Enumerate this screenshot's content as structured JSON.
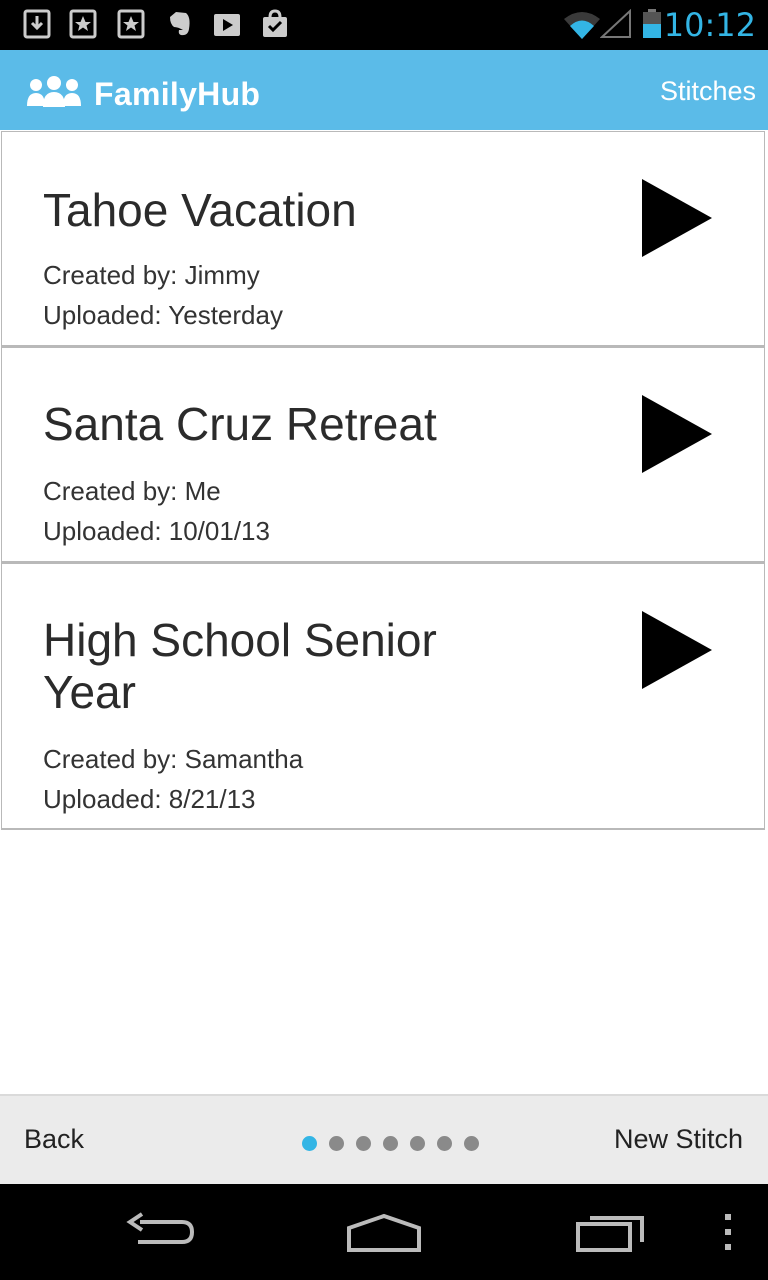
{
  "status_bar": {
    "time": "10:12",
    "accent_color": "#33b5e5",
    "notification_icons": [
      "download-icon",
      "bookmark-star-icon",
      "bookmark-star-icon",
      "evernote-icon",
      "play-store-icon",
      "shopping-bag-check-icon"
    ],
    "system_icons": [
      "wifi-icon",
      "signal-icon",
      "battery-icon"
    ]
  },
  "app_bar": {
    "title": "FamilyHub",
    "action_label": "Stitches",
    "logo_icon": "family-people-icon",
    "color": "#5bbbe8"
  },
  "stitches": [
    {
      "title": "Tahoe Vacation",
      "created_by": "Created by: Jimmy",
      "uploaded": "Uploaded: Yesterday"
    },
    {
      "title": "Santa Cruz Retreat",
      "created_by": "Created by: Me",
      "uploaded": "Uploaded: 10/01/13"
    },
    {
      "title": "High School Senior Year",
      "created_by": "Created by: Samantha",
      "uploaded": "Uploaded: 8/21/13"
    }
  ],
  "bottom_bar": {
    "back_label": "Back",
    "new_label": "New Stitch",
    "page_indicator": {
      "total": 7,
      "current": 1
    }
  },
  "nav_bar": {
    "icons": [
      "back-icon",
      "home-icon",
      "recent-apps-icon",
      "overflow-menu-icon"
    ]
  }
}
